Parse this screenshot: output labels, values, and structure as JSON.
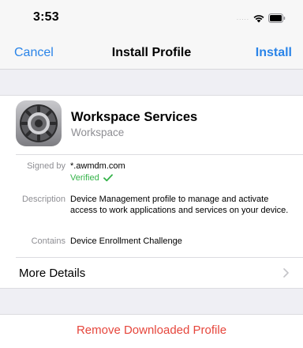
{
  "status_bar": {
    "time": "3:53",
    "signal": ".....",
    "icons": [
      "wifi-icon",
      "battery-icon"
    ]
  },
  "nav": {
    "cancel_label": "Cancel",
    "title": "Install Profile",
    "install_label": "Install",
    "accent_color": "#2a84e8"
  },
  "profile": {
    "icon": "settings-gear-icon",
    "name": "Workspace Services",
    "organization": "Workspace"
  },
  "details": {
    "signed_by_label": "Signed by",
    "signed_by_value": "*.awmdm.com",
    "verified_label": "Verified",
    "verified_color": "#35b34a",
    "description_label": "Description",
    "description_value": "Device Management profile to manage and activate access to work applications and services on your device.",
    "contains_label": "Contains",
    "contains_value": "Device Enrollment Challenge"
  },
  "more_details": {
    "label": "More Details",
    "icon": "chevron-right-icon"
  },
  "remove": {
    "label": "Remove Downloaded Profile",
    "color": "#e6463c"
  }
}
